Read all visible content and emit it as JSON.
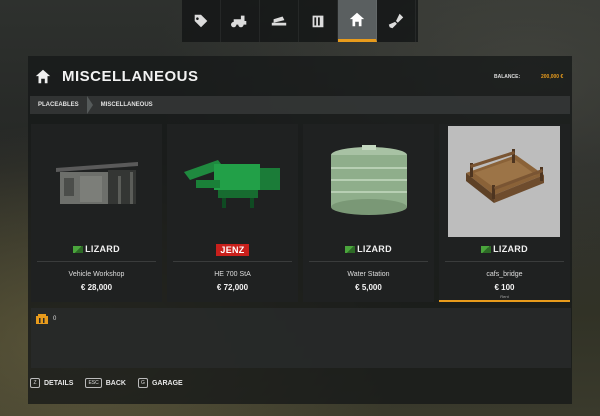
{
  "tabs": [
    {
      "icon": "tag-icon"
    },
    {
      "icon": "tractor-icon"
    },
    {
      "icon": "tools-icon"
    },
    {
      "icon": "silo-icon"
    },
    {
      "icon": "home-icon",
      "active": true
    },
    {
      "icon": "shovel-icon"
    }
  ],
  "header": {
    "title": "MISCELLANEOUS",
    "balance_label": "BALANCE:",
    "balance_value": "200,000 €"
  },
  "breadcrumb": [
    "PLACEABLES",
    "MISCELLANEOUS"
  ],
  "items": [
    {
      "brand": "LIZARD",
      "name": "Vehicle Workshop",
      "price": "€ 28,000"
    },
    {
      "brand": "JENZ",
      "name": "HE 700 StA",
      "price": "€ 72,000"
    },
    {
      "brand": "LIZARD",
      "name": "Water Station",
      "price": "€ 5,000"
    },
    {
      "brand": "LIZARD",
      "name": "cafs_bridge",
      "price": "€ 100",
      "note": "Rent",
      "selected": true
    }
  ],
  "info": {
    "value": "0"
  },
  "footer": [
    {
      "key": "Z",
      "label": "DETAILS"
    },
    {
      "key": "ESC",
      "label": "BACK"
    },
    {
      "key": "G",
      "label": "GARAGE"
    }
  ],
  "colors": {
    "accent": "#e89b1c",
    "jenz_red": "#c8201c",
    "lizard_green": "#4aa53c"
  }
}
